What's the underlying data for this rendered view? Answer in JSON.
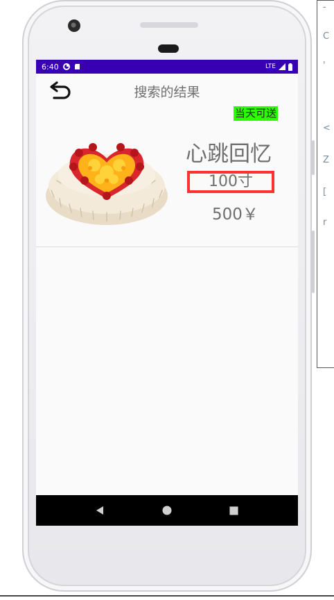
{
  "status_bar": {
    "time": "6:40",
    "network": "LTE",
    "background_color": "#3700b3"
  },
  "app_bar": {
    "title": "搜索的结果",
    "back_icon": "back-arrow-icon"
  },
  "result": {
    "badge": "当天可送",
    "badge_color": "#2bff00",
    "name": "心跳回忆",
    "size": "100寸",
    "price": "500￥",
    "highlight_color": "#ff3131",
    "image_icon": "cake-image"
  },
  "nav_bar": {
    "icons": [
      "back-triangle-icon",
      "home-circle-icon",
      "recents-square-icon"
    ]
  },
  "background_window": {
    "glyphs": [
      "-",
      "C",
      "'",
      "<",
      "Z",
      "[",
      "r"
    ]
  }
}
